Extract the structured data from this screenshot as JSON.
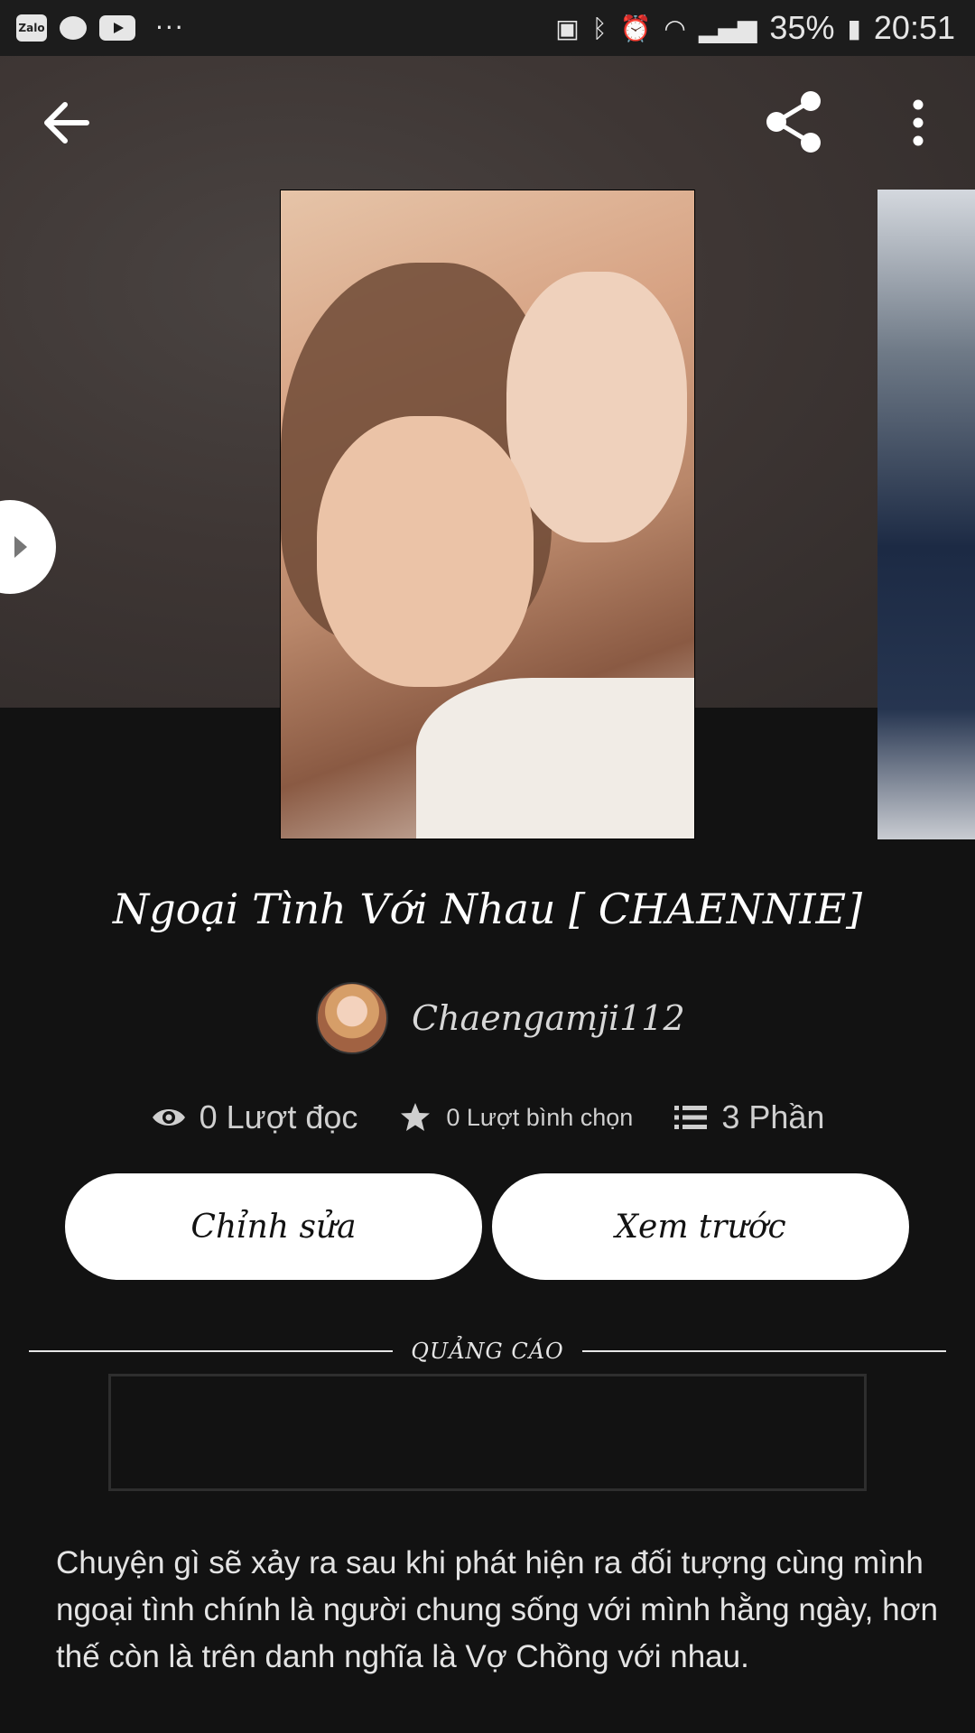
{
  "status_bar": {
    "app_zalo": "Zalo",
    "more": "···",
    "battery_percent": "35%",
    "time": "20:51"
  },
  "story": {
    "title": "Ngoại Tình Với Nhau [ CHAENNIE]",
    "author": "Chaengamji112",
    "stats": {
      "reads": "0 Lượt đọc",
      "votes": "0 Lượt bình chọn",
      "parts": "3 Phần"
    },
    "description": "Chuyện gì sẽ xảy ra sau khi phát hiện ra đối tượng cùng mình ngoại tình chính là người chung sống với mình hằng ngày, hơn thế còn là trên danh nghĩa là Vợ Chồng với nhau."
  },
  "actions": {
    "edit_label": "Chỉnh sửa",
    "preview_label": "Xem trước"
  },
  "ad": {
    "label": "QUẢNG CÁO"
  },
  "icons": {
    "back": "arrow-left-icon",
    "share": "share-icon",
    "menu": "more-vertical-icon",
    "reads": "eye-icon",
    "votes": "star-icon",
    "parts": "list-icon"
  }
}
